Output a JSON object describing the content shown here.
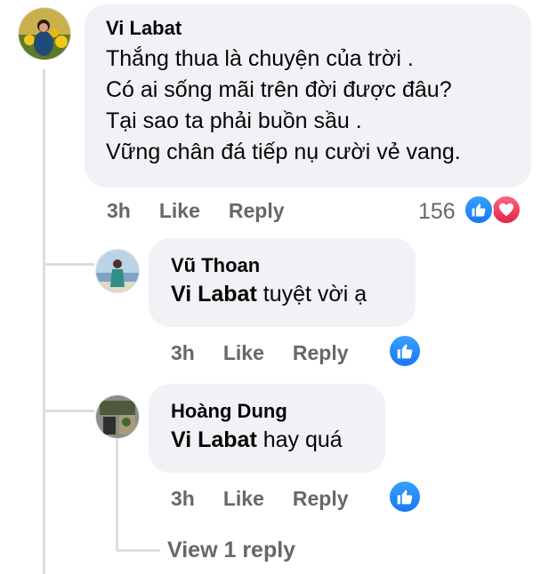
{
  "comment": {
    "author": "Vi Labat",
    "text": "Thắng thua là chuyện của trời .\nCó ai sống mãi trên đời được đâu?\nTại sao ta phải buồn sầu .\nVững chân đá tiếp nụ cười vẻ vang.",
    "time": "3h",
    "like_label": "Like",
    "reply_label": "Reply",
    "reaction_count": "156",
    "reactions": [
      "like-icon",
      "love-icon"
    ]
  },
  "replies": [
    {
      "author": "Vũ Thoan",
      "mention": "Vi Labat",
      "text": " tuyệt vời ạ",
      "time": "3h",
      "like_label": "Like",
      "reply_label": "Reply"
    },
    {
      "author": "Hoàng Dung",
      "mention": "Vi Labat",
      "text": " hay quá",
      "time": "3h",
      "like_label": "Like",
      "reply_label": "Reply"
    }
  ],
  "view_replies_label": "View 1 reply",
  "colors": {
    "bubble": "#f0f2f5",
    "meta": "#65676b",
    "like": "#1877f2",
    "love": "#e4234a",
    "thread_line": "#dadde1"
  }
}
